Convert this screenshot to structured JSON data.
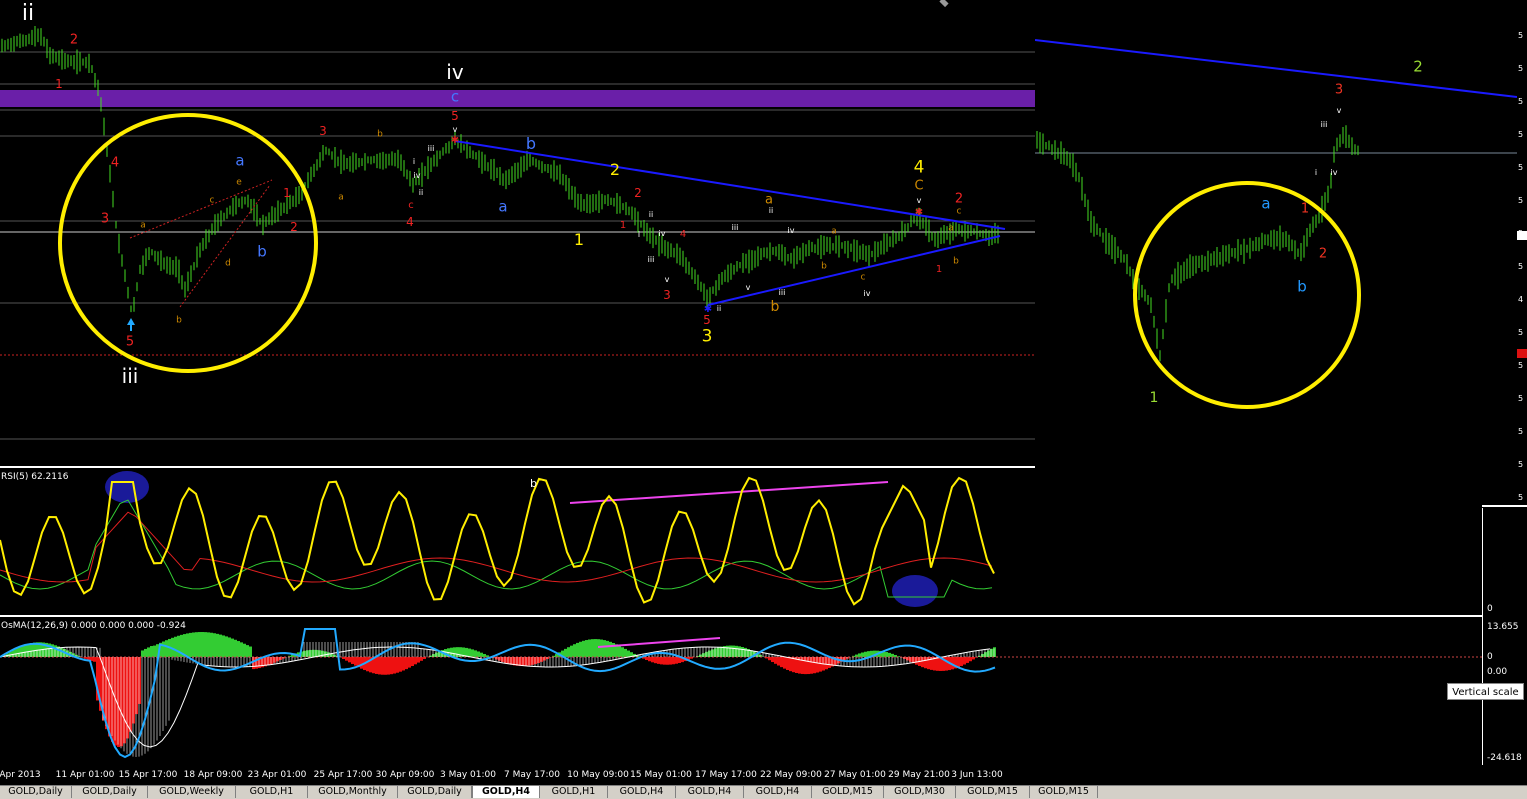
{
  "colors": {
    "background": "#000000",
    "bars": "#44dd22",
    "trendline": "#1a1aff",
    "circle": "#ffee00",
    "band": "#6a1fa8",
    "rsi": "#ffee00",
    "signal_red": "#e02020",
    "signal_green": "#33cc33",
    "osma_pos": "#33cc33",
    "osma_neg": "#ee1111",
    "macd_line": "#22aaff",
    "divergence": "#ee44ee"
  },
  "main_wave_labels": [
    {
      "t": "ii",
      "c": "#ffffff",
      "s": 22
    },
    {
      "t": "2",
      "c": "#ee2222",
      "s": 13
    },
    {
      "t": "1",
      "c": "#ee2222",
      "s": 12
    },
    {
      "t": "4",
      "c": "#ee2222",
      "s": 13
    },
    {
      "t": "3",
      "c": "#ee2222",
      "s": 13
    },
    {
      "t": "5",
      "c": "#ee2222",
      "s": 13
    },
    {
      "t": "iii",
      "c": "#ffffff",
      "s": 20
    },
    {
      "t": "a",
      "c": "#4477ff",
      "s": 15
    },
    {
      "t": "b",
      "c": "#4477ff",
      "s": 15
    },
    {
      "t": "a",
      "c": "#cc8800",
      "s": 9
    },
    {
      "t": "c",
      "c": "#cc8800",
      "s": 9
    },
    {
      "t": "e",
      "c": "#cc8800",
      "s": 9
    },
    {
      "t": "d",
      "c": "#cc8800",
      "s": 9
    },
    {
      "t": "b",
      "c": "#cc8800",
      "s": 9
    },
    {
      "t": "1",
      "c": "#ee2222",
      "s": 12
    },
    {
      "t": "2",
      "c": "#ee2222",
      "s": 12
    },
    {
      "t": "3",
      "c": "#ee2222",
      "s": 12
    },
    {
      "t": "b",
      "c": "#cc8800",
      "s": 9
    },
    {
      "t": "a",
      "c": "#cc8800",
      "s": 9
    },
    {
      "t": "i",
      "c": "#ffffff",
      "s": 8
    },
    {
      "t": "iv",
      "c": "#ffffff",
      "s": 8
    },
    {
      "t": "ii",
      "c": "#ffffff",
      "s": 8
    },
    {
      "t": "c",
      "c": "#ee2222",
      "s": 10
    },
    {
      "t": "4",
      "c": "#ee2222",
      "s": 12
    },
    {
      "t": "iii",
      "c": "#ffffff",
      "s": 8
    },
    {
      "t": "iv",
      "c": "#ffffff",
      "s": 20
    },
    {
      "t": "c",
      "c": "#4477ff",
      "s": 15
    },
    {
      "t": "5",
      "c": "#ee2222",
      "s": 12
    },
    {
      "t": "v",
      "c": "#ffffff",
      "s": 8
    },
    {
      "t": "b",
      "c": "#4477ff",
      "s": 16
    },
    {
      "t": "a",
      "c": "#4477ff",
      "s": 15
    },
    {
      "t": "2",
      "c": "#ffee00",
      "s": 16
    },
    {
      "t": "1",
      "c": "#ffee00",
      "s": 16
    },
    {
      "t": "2",
      "c": "#ee2222",
      "s": 12
    },
    {
      "t": "1",
      "c": "#ee2222",
      "s": 10
    },
    {
      "t": "ii",
      "c": "#ffffff",
      "s": 8
    },
    {
      "t": "i",
      "c": "#ffffff",
      "s": 8
    },
    {
      "t": "iv",
      "c": "#ffffff",
      "s": 8
    },
    {
      "t": "iii",
      "c": "#ffffff",
      "s": 8
    },
    {
      "t": "4",
      "c": "#ee2222",
      "s": 10
    },
    {
      "t": "v",
      "c": "#ffffff",
      "s": 8
    },
    {
      "t": "3",
      "c": "#ee2222",
      "s": 12
    },
    {
      "t": "5",
      "c": "#ee2222",
      "s": 12
    },
    {
      "t": "3",
      "c": "#ffee00",
      "s": 17
    },
    {
      "t": "ii",
      "c": "#ffffff",
      "s": 8
    },
    {
      "t": "iii",
      "c": "#ffffff",
      "s": 8
    },
    {
      "t": "iv",
      "c": "#ffffff",
      "s": 8
    },
    {
      "t": "v",
      "c": "#ffffff",
      "s": 8
    },
    {
      "t": "ii",
      "c": "#ffffff",
      "s": 8
    },
    {
      "t": "a",
      "c": "#cc8800",
      "s": 13
    },
    {
      "t": "b",
      "c": "#cc8800",
      "s": 14
    },
    {
      "t": "iii",
      "c": "#ffffff",
      "s": 8
    },
    {
      "t": "a",
      "c": "#cc8800",
      "s": 9
    },
    {
      "t": "b",
      "c": "#cc8800",
      "s": 9
    },
    {
      "t": "c",
      "c": "#cc8800",
      "s": 9
    },
    {
      "t": "iv",
      "c": "#ffffff",
      "s": 8
    },
    {
      "t": "4",
      "c": "#ffee00",
      "s": 17
    },
    {
      "t": "C",
      "c": "#cc8800",
      "s": 13
    },
    {
      "t": "v",
      "c": "#ffffff",
      "s": 8
    },
    {
      "t": "2",
      "c": "#ee2222",
      "s": 13
    },
    {
      "t": "c",
      "c": "#cc8800",
      "s": 9
    },
    {
      "t": "a",
      "c": "#cc8800",
      "s": 9
    },
    {
      "t": "b",
      "c": "#cc8800",
      "s": 9
    },
    {
      "t": "1",
      "c": "#ee2222",
      "s": 10
    }
  ],
  "right_wave_labels": [
    {
      "t": "2",
      "c": "#99dd33",
      "s": 15
    },
    {
      "t": "3",
      "c": "#ee3322",
      "s": 13
    },
    {
      "t": "v",
      "c": "#ffffff",
      "s": 8
    },
    {
      "t": "iii",
      "c": "#ffffff",
      "s": 8
    },
    {
      "t": "i",
      "c": "#ffffff",
      "s": 8
    },
    {
      "t": "iv",
      "c": "#ffffff",
      "s": 8
    },
    {
      "t": "a",
      "c": "#2299ff",
      "s": 15
    },
    {
      "t": "1",
      "c": "#ee3322",
      "s": 13
    },
    {
      "t": "2",
      "c": "#ee3322",
      "s": 13
    },
    {
      "t": "b",
      "c": "#2299ff",
      "s": 15
    },
    {
      "t": "1",
      "c": "#99dd33",
      "s": 14
    }
  ],
  "rsi": {
    "label": "RSI(5) 62.2116",
    "annot": "b"
  },
  "osma": {
    "label": "OsMA(12,26,9) 0.000 0.000 0.000 -0.924"
  },
  "vertical_scale": {
    "ticks": [
      "13.655",
      "0",
      "0.00",
      "-24.618"
    ],
    "rsi_zero": "0",
    "tooltip": "Vertical scale"
  },
  "right_scale": {
    "ticks": [
      "5",
      "5",
      "5",
      "5",
      "5",
      "5",
      "5",
      "5",
      "4",
      "5",
      "5",
      "5",
      "5",
      "5",
      "5"
    ]
  },
  "time_axis": [
    "Apr 2013",
    "11 Apr 01:00",
    "15 Apr 17:00",
    "18 Apr 09:00",
    "23 Apr 01:00",
    "25 Apr 17:00",
    "30 Apr 09:00",
    "3 May 01:00",
    "7 May 17:00",
    "10 May 09:00",
    "15 May 01:00",
    "17 May 17:00",
    "22 May 09:00",
    "27 May 01:00",
    "29 May 21:00",
    "3 Jun 13:00"
  ],
  "tabs": [
    {
      "label": "GOLD,Daily",
      "active": false
    },
    {
      "label": "GOLD,Daily",
      "active": false
    },
    {
      "label": "GOLD,Weekly",
      "active": false
    },
    {
      "label": "GOLD,H1",
      "active": false
    },
    {
      "label": "GOLD,Monthly",
      "active": false
    },
    {
      "label": "GOLD,Daily",
      "active": false
    },
    {
      "label": "GOLD,H4",
      "active": true
    },
    {
      "label": "GOLD,H1",
      "active": false
    },
    {
      "label": "GOLD,H4",
      "active": false
    },
    {
      "label": "GOLD,H4",
      "active": false
    },
    {
      "label": "GOLD,H4",
      "active": false
    },
    {
      "label": "GOLD,M15",
      "active": false
    },
    {
      "label": "GOLD,M30",
      "active": false
    },
    {
      "label": "GOLD,M15",
      "active": false
    },
    {
      "label": "GOLD,M15",
      "active": false
    }
  ]
}
